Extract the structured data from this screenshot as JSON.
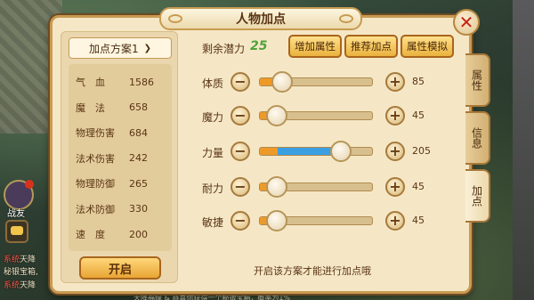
{
  "dialog": {
    "title": "人物加点",
    "close_label": "✕"
  },
  "left_panel": {
    "scheme_label": "加点方案1",
    "stats": [
      {
        "label": "气　血",
        "value": "1586"
      },
      {
        "label": "魔　法",
        "value": "658"
      },
      {
        "label": "物理伤害",
        "value": "684"
      },
      {
        "label": "法术伤害",
        "value": "242"
      },
      {
        "label": "物理防御",
        "value": "265"
      },
      {
        "label": "法术防御",
        "value": "330"
      },
      {
        "label": "速　度",
        "value": "200"
      }
    ],
    "open_button": "开启"
  },
  "potential": {
    "label": "剩余潜力",
    "value": "25"
  },
  "top_buttons": [
    "增加属性",
    "推荐加点",
    "属性模拟"
  ],
  "attributes": [
    {
      "name": "体质",
      "value": "85",
      "base_fraction": 0.16,
      "total_fraction": 0.2
    },
    {
      "name": "魔力",
      "value": "45",
      "base_fraction": 0.16,
      "total_fraction": 0.16
    },
    {
      "name": "力量",
      "value": "205",
      "base_fraction": 0.16,
      "total_fraction": 0.72
    },
    {
      "name": "耐力",
      "value": "45",
      "base_fraction": 0.16,
      "total_fraction": 0.16
    },
    {
      "name": "敏捷",
      "value": "45",
      "base_fraction": 0.16,
      "total_fraction": 0.16
    }
  ],
  "hint": "开启该方案才能进行加点哦",
  "side_tabs": [
    {
      "label": "属性"
    },
    {
      "label": "信息"
    },
    {
      "label": "加点"
    }
  ],
  "hud": {
    "avatar_label": "战友",
    "log_lines": [
      {
        "tag": "系统",
        "text": "天降"
      },
      {
        "tag": "",
        "text": "秘银宝箱,"
      },
      {
        "tag": "系统",
        "text": "天降"
      }
    ],
    "ticker": "天降福缘 & 恭喜你获得一个秘银宝箱，概率为1%"
  },
  "colors": {
    "panel_bg": "#f5e7c6",
    "potential_green": "#4ea33a",
    "bar_orange": "#ee9a28",
    "bar_blue": "#3aa0e2",
    "close_red": "#c52515"
  }
}
